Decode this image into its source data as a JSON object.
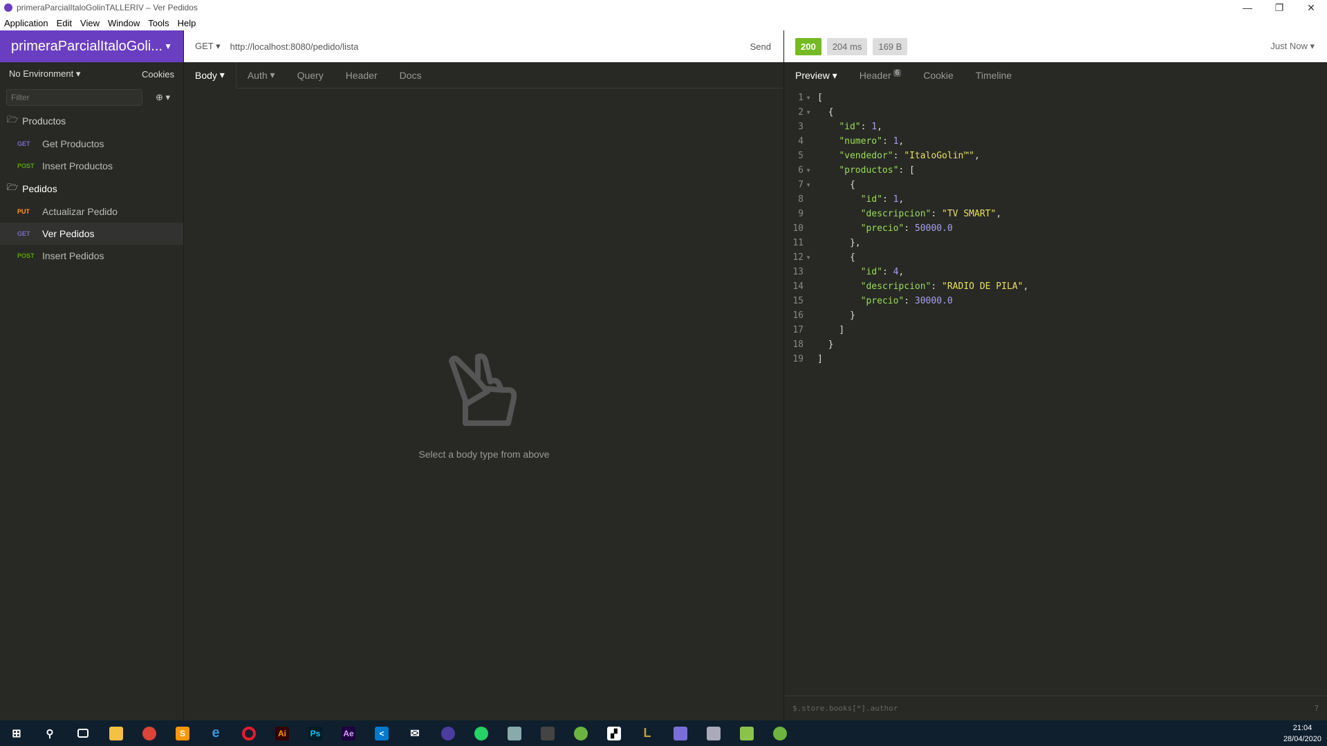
{
  "window": {
    "title": "primeraParcialItaloGolinTALLERIV – Ver Pedidos",
    "minimize": "—",
    "restore": "❐",
    "close": "✕"
  },
  "menu": [
    "Application",
    "Edit",
    "View",
    "Window",
    "Tools",
    "Help"
  ],
  "sidebar": {
    "workspace": "primeraParcialItaloGoli...",
    "environment": "No Environment",
    "cookies": "Cookies",
    "filter_placeholder": "Filter",
    "folders": [
      {
        "name": "Productos",
        "items": [
          {
            "method": "GET",
            "label": "Get Productos"
          },
          {
            "method": "POST",
            "label": "Insert Productos"
          }
        ]
      },
      {
        "name": "Pedidos",
        "items": [
          {
            "method": "PUT",
            "label": "Actualizar Pedido"
          },
          {
            "method": "GET",
            "label": "Ver Pedidos"
          },
          {
            "method": "POST",
            "label": "Insert Pedidos"
          }
        ]
      }
    ]
  },
  "request": {
    "method": "GET",
    "url": "http://localhost:8080/pedido/lista",
    "send": "Send",
    "tabs": [
      "Body",
      "Auth",
      "Query",
      "Header",
      "Docs"
    ],
    "empty_message": "Select a body type from above"
  },
  "response": {
    "status": "200",
    "time": "204 ms",
    "size": "169 B",
    "when": "Just Now",
    "tabs": [
      "Preview",
      "Header",
      "Cookie",
      "Timeline"
    ],
    "header_count": "6",
    "jsonpath_placeholder": "$.store.books[*].author",
    "help": "?"
  },
  "taskbar": {
    "time": "21:04",
    "date": "28/04/2020",
    "icons": [
      "windows-start-icon",
      "search-icon",
      "task-view-icon",
      "file-explorer-icon",
      "chrome-icon",
      "sublime-icon",
      "edge-icon",
      "opera-icon",
      "illustrator-icon",
      "photoshop-icon",
      "after-effects-icon",
      "vscode-icon",
      "mail-icon",
      "eclipse-icon",
      "whatsapp-icon",
      "app-icon",
      "app-icon",
      "spring-icon",
      "sticky-icon",
      "league-icon",
      "app-icon",
      "app-icon",
      "notepad-icon",
      "spring-icon"
    ]
  },
  "colors": {
    "accent": "#6a3ec1",
    "ok": "#75ba24"
  }
}
